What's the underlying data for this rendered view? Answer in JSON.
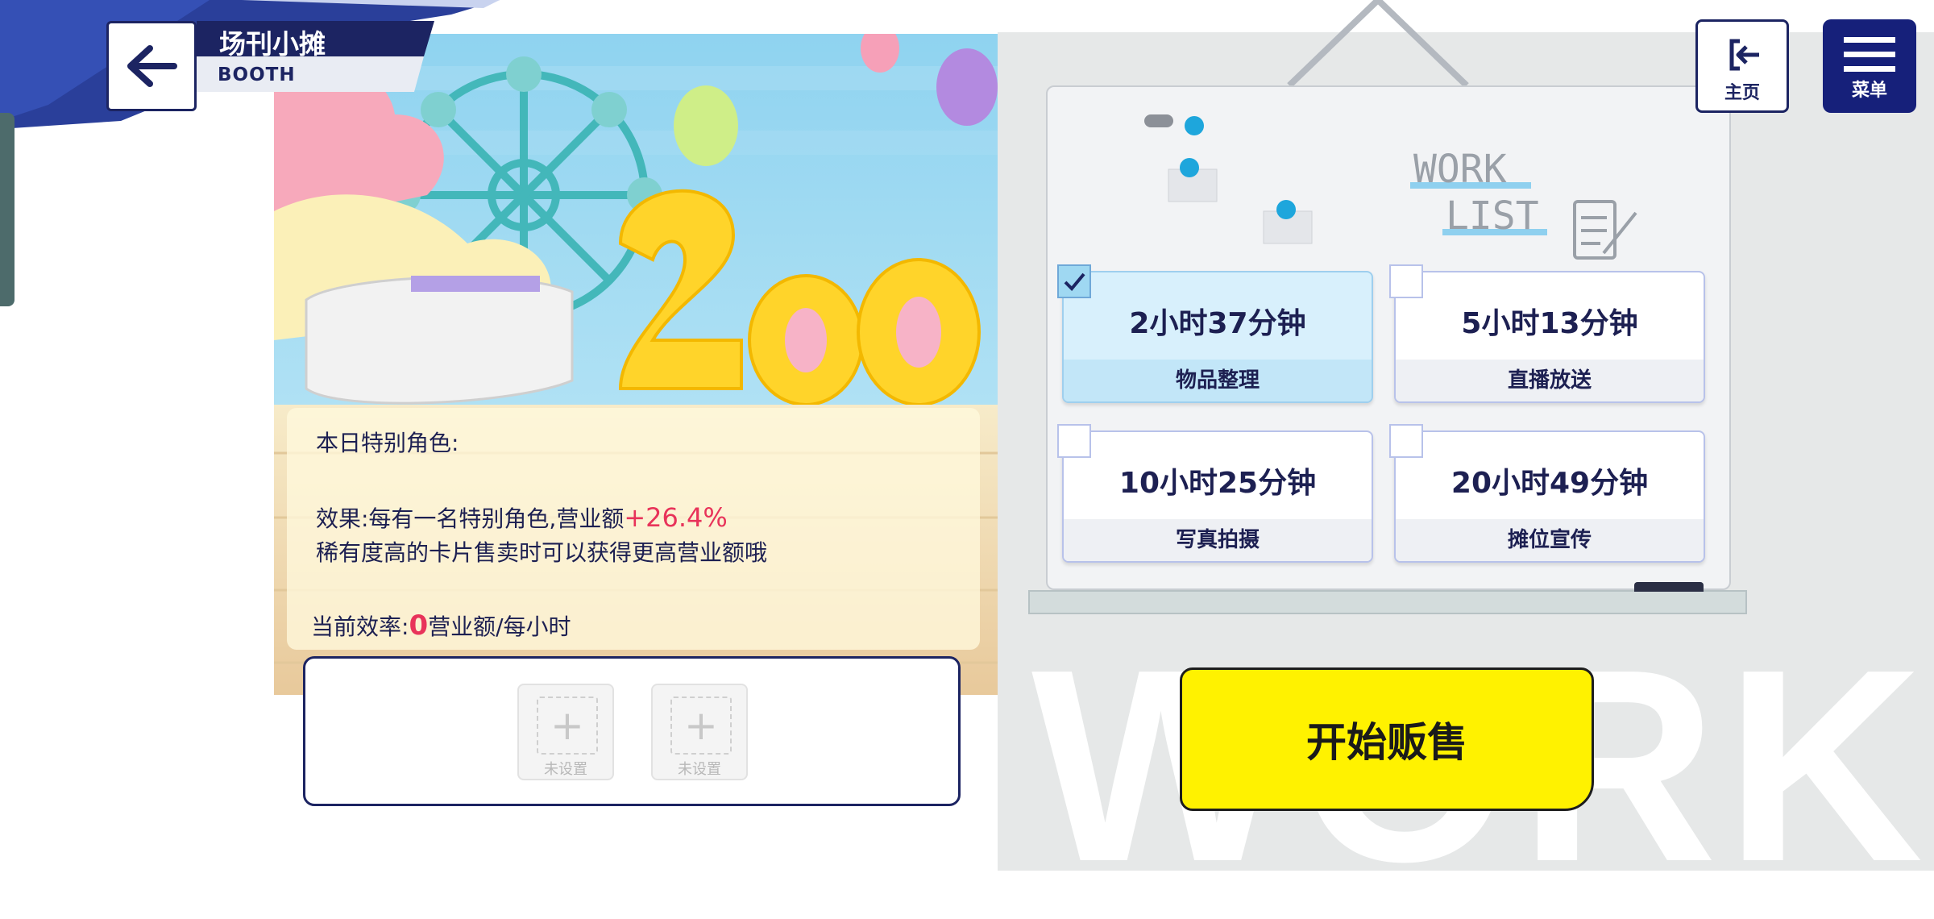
{
  "header": {
    "title": "场刊小摊",
    "subtitle": "BOOTH"
  },
  "info": {
    "special_label": "本日特别角色:",
    "effect_prefix": "效果:每有一名特别角色,营业额",
    "effect_value": "+26.4%",
    "rarity_note": "稀有度高的卡片售卖时可以获得更高营业额哦",
    "efficiency_prefix": "当前效率:",
    "efficiency_value": "0",
    "efficiency_unit": "营业额/每小时"
  },
  "slots": [
    {
      "label": "未设置"
    },
    {
      "label": "未设置"
    }
  ],
  "work_list": {
    "tasks": [
      {
        "time": "2小时37分钟",
        "name": "物品整理",
        "selected": true
      },
      {
        "time": "5小时13分钟",
        "name": "直播放送",
        "selected": false
      },
      {
        "time": "10小时25分钟",
        "name": "写真拍摄",
        "selected": false
      },
      {
        "time": "20小时49分钟",
        "name": "摊位宣传",
        "selected": false
      }
    ],
    "deco_text_1": "WORK",
    "deco_text_2": "LIST"
  },
  "watermark": "WORK",
  "buttons": {
    "start_sale": "开始贩售",
    "home": "主页",
    "menu": "菜单"
  },
  "colors": {
    "navy": "#1c2462",
    "accent_red": "#e8335a",
    "start_yellow": "#fff200",
    "selected_blue": "#d8f0fc"
  }
}
